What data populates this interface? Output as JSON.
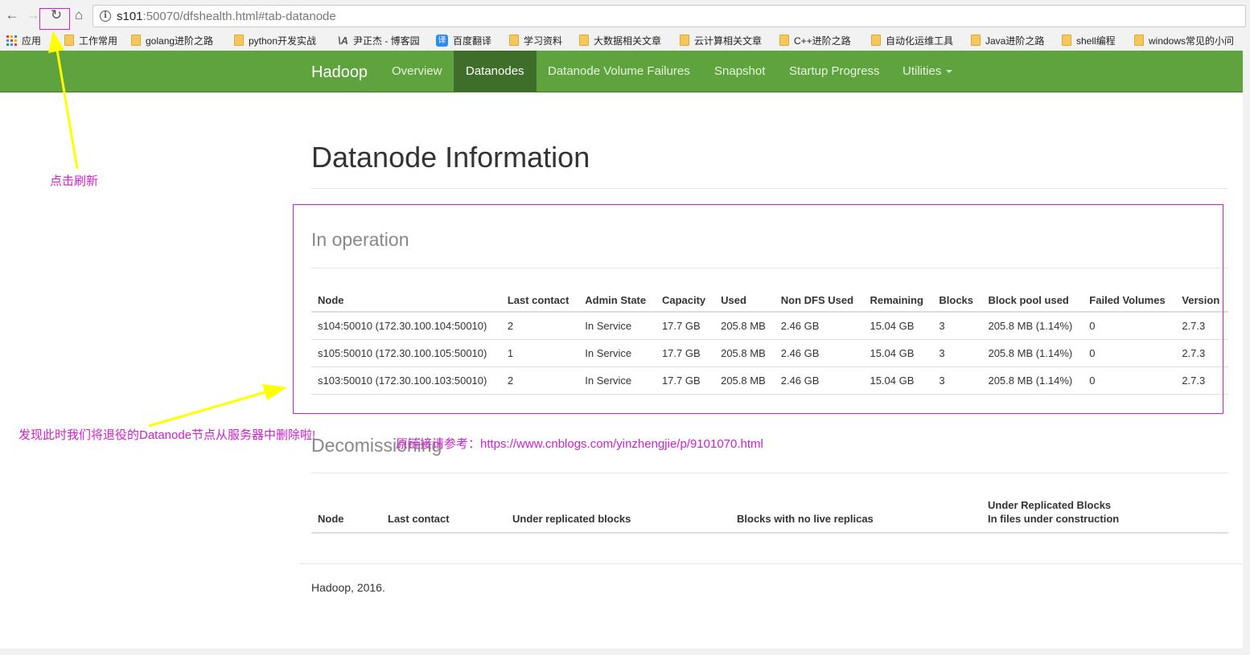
{
  "browser": {
    "url_host": "s101",
    "url_rest": ":50070/dfshealth.html#tab-datanode",
    "bookmarks": [
      {
        "label": "应用",
        "icon": "apps-icon"
      },
      {
        "label": "工作常用",
        "icon": "folder-icon"
      },
      {
        "label": "golang进阶之路",
        "icon": "folder-icon"
      },
      {
        "label": "python开发实战",
        "icon": "folder-icon"
      },
      {
        "label": "尹正杰 - 博客园",
        "icon": "blog-icon"
      },
      {
        "label": "百度翻译",
        "icon": "translate-icon"
      },
      {
        "label": "学习资料",
        "icon": "folder-icon"
      },
      {
        "label": "大数据相关文章",
        "icon": "folder-icon"
      },
      {
        "label": "云计算相关文章",
        "icon": "folder-icon"
      },
      {
        "label": "C++进阶之路",
        "icon": "folder-icon"
      },
      {
        "label": "自动化运维工具",
        "icon": "folder-icon"
      },
      {
        "label": "Java进阶之路",
        "icon": "folder-icon"
      },
      {
        "label": "shell编程",
        "icon": "folder-icon"
      },
      {
        "label": "windows常见的小问",
        "icon": "folder-icon"
      }
    ]
  },
  "navbar": {
    "brand": "Hadoop",
    "items": [
      "Overview",
      "Datanodes",
      "Datanode Volume Failures",
      "Snapshot",
      "Startup Progress",
      "Utilities"
    ],
    "active": "Datanodes"
  },
  "main": {
    "title": "Datanode Information",
    "in_operation": {
      "heading": "In operation",
      "columns": [
        "Node",
        "Last contact",
        "Admin State",
        "Capacity",
        "Used",
        "Non DFS Used",
        "Remaining",
        "Blocks",
        "Block pool used",
        "Failed Volumes",
        "Version"
      ],
      "rows": [
        [
          "s104:50010 (172.30.100.104:50010)",
          "2",
          "In Service",
          "17.7 GB",
          "205.8 MB",
          "2.46 GB",
          "15.04 GB",
          "3",
          "205.8 MB (1.14%)",
          "0",
          "2.7.3"
        ],
        [
          "s105:50010 (172.30.100.105:50010)",
          "1",
          "In Service",
          "17.7 GB",
          "205.8 MB",
          "2.46 GB",
          "15.04 GB",
          "3",
          "205.8 MB (1.14%)",
          "0",
          "2.7.3"
        ],
        [
          "s103:50010 (172.30.100.103:50010)",
          "2",
          "In Service",
          "17.7 GB",
          "205.8 MB",
          "2.46 GB",
          "15.04 GB",
          "3",
          "205.8 MB (1.14%)",
          "0",
          "2.7.3"
        ]
      ]
    },
    "decomissioning": {
      "heading": "Decomissioning",
      "columns": [
        "Node",
        "Last contact",
        "Under replicated blocks",
        "Blocks with no live replicas"
      ],
      "last_column_line1": "Under Replicated Blocks",
      "last_column_line2": "In files under construction"
    },
    "footer": "Hadoop, 2016."
  },
  "annotations": {
    "refresh_note": "点击刷新",
    "removed_note": "发现此时我们将退役的Datanode节点从服务器中删除啦!",
    "source_note": "原链接请参考：https://www.cnblogs.com/yinzhengjie/p/9101070.html",
    "color": "#d020d0",
    "arrow_color": "#ffff00"
  }
}
